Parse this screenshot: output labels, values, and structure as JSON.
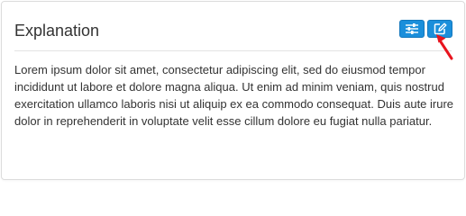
{
  "panel": {
    "title": "Explanation",
    "body": "Lorem ipsum dolor sit amet, consectetur adipiscing elit, sed do eiusmod tempor incididunt ut labore et dolore magna aliqua. Ut enim ad minim veniam, quis nostrud exercitation ullamco laboris nisi ut aliquip ex ea commodo consequat. Duis aute irure dolor in reprehenderit in voluptate velit esse cillum dolore eu fugiat nulla pariatur."
  },
  "toolbar": {
    "buttons": [
      {
        "icon": "sliders-icon"
      },
      {
        "icon": "edit-icon"
      }
    ]
  },
  "annotation": {
    "icon": "red-arrow-icon",
    "color": "#e8141e"
  },
  "colors": {
    "button_bg": "#1b8fdb",
    "button_border": "#1478bd",
    "text": "#333333",
    "divider": "#e3e3e3"
  }
}
